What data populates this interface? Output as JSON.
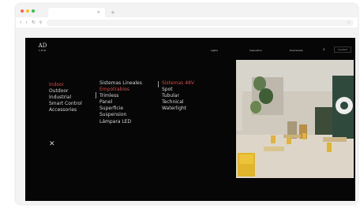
{
  "browser": {
    "traffic_lights": [
      "#ff5f57",
      "#febc2e",
      "#28c840"
    ],
    "tab_close": "×",
    "new_tab": "+",
    "nav_icons": [
      "‹",
      "›",
      "↻"
    ],
    "url_star": "☆"
  },
  "site": {
    "logo_main": "AD",
    "logo_sub": "LED",
    "topnav": [
      "Lights",
      "Inspiration",
      "Downloads"
    ],
    "search_icon": "⌕",
    "cta_label": "Contact",
    "menu_col1": [
      "Indoor",
      "Outdoor",
      "Industrial",
      "Smart Control",
      "Accessories"
    ],
    "menu_col2": [
      "Sistemas Lineales",
      "Empotrables",
      "Trimless",
      "Panel",
      "Superficie",
      "Suspension",
      "Lámpara LED"
    ],
    "menu_col3": [
      "Sistemas 48V",
      "Spot",
      "Tubular",
      "Technical",
      "Waterlight"
    ],
    "close_label": "✕",
    "accent_color": "#d24b4b",
    "hero_alt": "interior cafe with plants"
  }
}
